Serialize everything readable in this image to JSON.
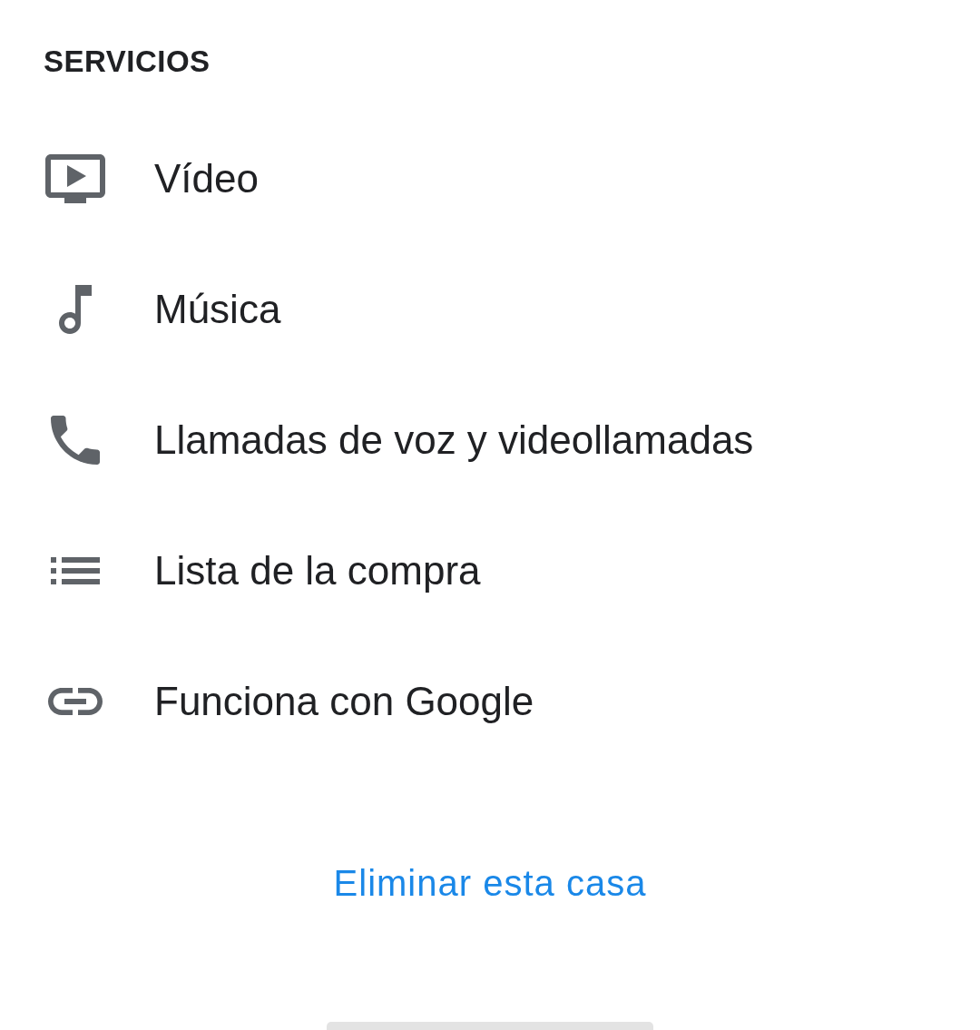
{
  "section_title": "SERVICIOS",
  "services": [
    {
      "label": "Vídeo"
    },
    {
      "label": "Música"
    },
    {
      "label": "Llamadas de voz y videollamadas"
    },
    {
      "label": "Lista de la compra"
    },
    {
      "label": "Funciona con Google"
    }
  ],
  "delete_link": "Eliminar esta casa"
}
